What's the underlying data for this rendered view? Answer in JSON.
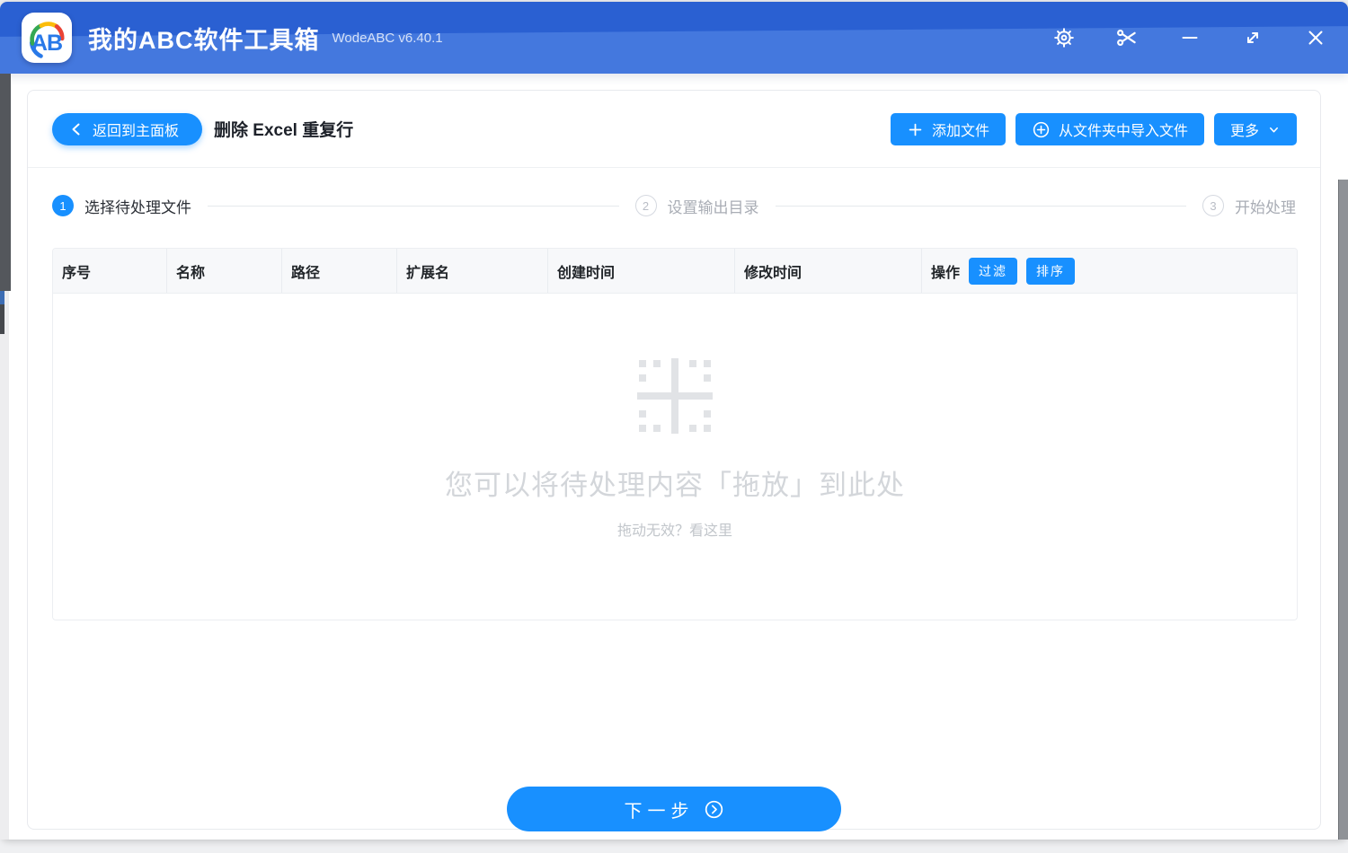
{
  "titlebar": {
    "app_title": "我的ABC软件工具箱",
    "version": "WodeABC v6.40.1",
    "logo_text": "AB",
    "icons": [
      "settings-icon",
      "scissors-icon",
      "minimize-icon",
      "maximize-icon",
      "close-icon"
    ]
  },
  "toolbar": {
    "back_label": "返回到主面板",
    "page_title": "删除 Excel 重复行",
    "add_files_label": "添加文件",
    "import_folder_label": "从文件夹中导入文件",
    "more_label": "更多"
  },
  "steps": [
    {
      "num": "1",
      "label": "选择待处理文件"
    },
    {
      "num": "2",
      "label": "设置输出目录"
    },
    {
      "num": "3",
      "label": "开始处理"
    }
  ],
  "table": {
    "columns": [
      "序号",
      "名称",
      "路径",
      "扩展名",
      "创建时间",
      "修改时间",
      "操作"
    ],
    "filter_label": "过滤",
    "sort_label": "排序",
    "rows": []
  },
  "dropzone": {
    "main_text": "您可以将待处理内容「拖放」到此处",
    "sub_text": "拖动无效？看这里"
  },
  "footer": {
    "next_label": "下一步"
  },
  "colors": {
    "accent": "#1890ff",
    "titlebar_dark": "#2a60d2",
    "titlebar_light": "#4478de"
  }
}
